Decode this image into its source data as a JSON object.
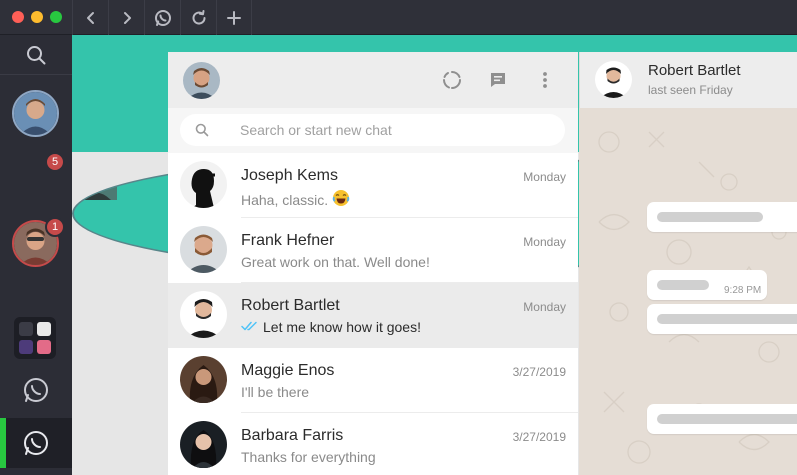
{
  "titlebar": {
    "traffic_colors": [
      "#fe5f57",
      "#febc2e",
      "#28c840"
    ],
    "nav_icons": [
      "back-icon",
      "forward-icon",
      "whatsapp-icon",
      "refresh-icon",
      "add-icon"
    ]
  },
  "sidebar": {
    "icons": [
      "search-icon",
      "avatar",
      "avatar",
      "avatar",
      "apps-icon",
      "whatsapp-icon",
      "whatsapp-icon"
    ],
    "badges": {
      "second": "5",
      "third": "1"
    },
    "active_accent": "#28c840"
  },
  "colors": {
    "teal": "#34c4ab",
    "tick_blue": "#4fc3f7",
    "badge_red": "#c64a4a"
  },
  "header": {
    "icons": [
      "status-icon",
      "new-chat-icon",
      "menu-icon"
    ]
  },
  "search": {
    "placeholder": "Search or start new chat"
  },
  "chats": [
    {
      "name": "Joseph Kems",
      "date": "Monday",
      "preview": "Haha, classic.",
      "emoji": "😂"
    },
    {
      "name": "Frank Hefner",
      "date": "Monday",
      "preview": "Great work on that. Well done!"
    },
    {
      "name": "Robert Bartlet",
      "date": "Monday",
      "preview": "Let me know how it goes!",
      "read_ticks": true,
      "active": true
    },
    {
      "name": "Maggie Enos",
      "date": "3/27/2019",
      "preview": "I'll be there"
    },
    {
      "name": "Barbara Farris",
      "date": "3/27/2019",
      "preview": "Thanks for everything"
    }
  ],
  "conversation": {
    "name": "Robert Bartlet",
    "status": "last seen Friday",
    "message_time": "9:28 PM"
  }
}
